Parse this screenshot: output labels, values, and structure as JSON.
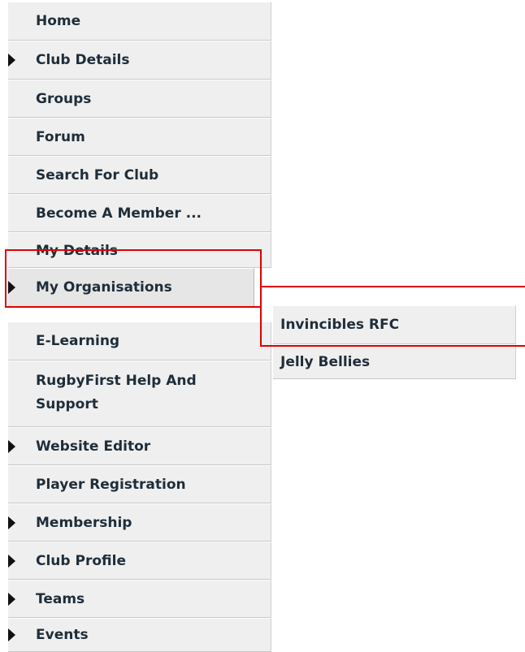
{
  "menu": {
    "items": [
      {
        "label": "Home",
        "has_submenu": false
      },
      {
        "label": "Club Details",
        "has_submenu": true
      },
      {
        "label": "Groups",
        "has_submenu": false
      },
      {
        "label": "Forum",
        "has_submenu": false
      },
      {
        "label": "Search For Club",
        "has_submenu": false
      },
      {
        "label": "Become A Member ...",
        "has_submenu": false
      },
      {
        "label": "My Details",
        "has_submenu": false
      },
      {
        "label": "My Organisations",
        "has_submenu": true,
        "active": true
      },
      {
        "label": "E-Learning",
        "has_submenu": false
      },
      {
        "label": "RugbyFirst Help And Support",
        "has_submenu": false
      },
      {
        "label": "Website Editor",
        "has_submenu": true
      },
      {
        "label": "Player Registration",
        "has_submenu": false
      },
      {
        "label": "Membership",
        "has_submenu": true
      },
      {
        "label": "Club Profile",
        "has_submenu": true
      },
      {
        "label": "Teams",
        "has_submenu": true
      },
      {
        "label": "Events",
        "has_submenu": true
      }
    ]
  },
  "submenu": {
    "items": [
      {
        "label": "Invincibles RFC"
      },
      {
        "label": "Jelly Bellies"
      }
    ]
  },
  "colors": {
    "highlight": "#e00000",
    "item_bg": "#efefef",
    "text": "#1f2d3a"
  }
}
